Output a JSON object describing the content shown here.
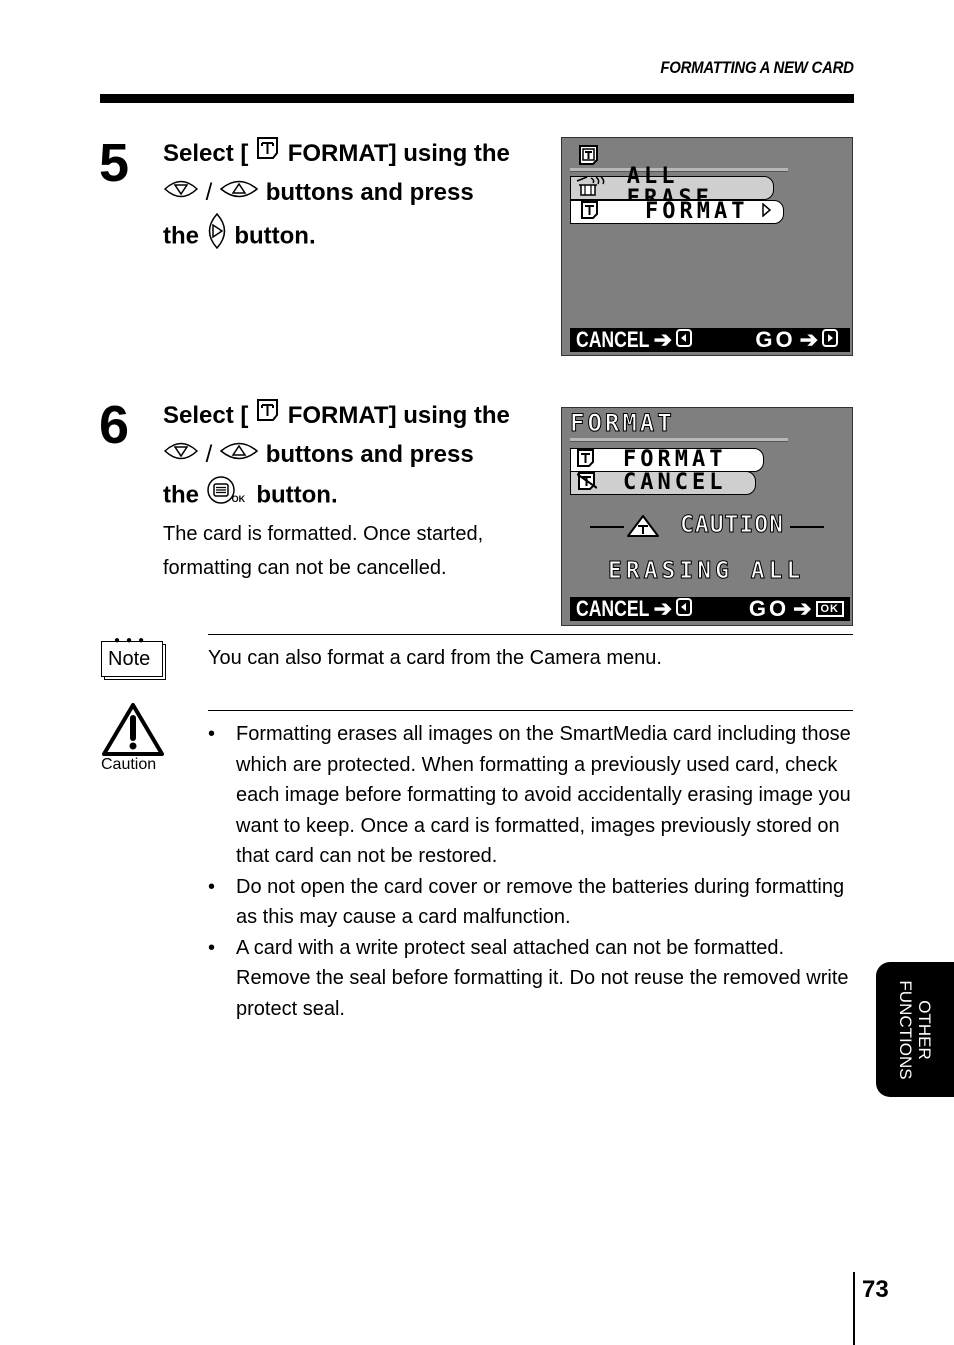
{
  "header": {
    "title": "FORMATTING A NEW CARD"
  },
  "steps": [
    {
      "number": "5",
      "line1_pre": "Select [",
      "line1_post": "FORMAT] using the",
      "line2_sep": "/",
      "line2_post": "buttons and press",
      "line3_pre": "the",
      "line3_post": "button.",
      "icons": [
        "card-format-icon",
        "down-arrow-button-icon",
        "up-arrow-button-icon",
        "right-arrow-button-icon"
      ],
      "screen": {
        "top_icon": "card-format-icon",
        "menu": [
          {
            "icon": "all-erase-icon",
            "label": "ALL ERASE",
            "selected": false
          },
          {
            "icon": "card-format-icon",
            "label": "FORMAT",
            "selected": true,
            "arrow": "right"
          }
        ],
        "bottom_left": "CANCEL",
        "bottom_left_key": "left-key-icon",
        "bottom_right": "GO",
        "bottom_right_key": "right-key-icon"
      }
    },
    {
      "number": "6",
      "line1_pre": "Select [",
      "line1_post": "FORMAT] using the",
      "line2_sep": "/",
      "line2_post": "buttons and press",
      "line3_pre": "the",
      "line3_post": "button.",
      "ok_sub": "OK",
      "description": "The card is formatted. Once started, formatting can not be cancelled.",
      "icons": [
        "card-format-icon",
        "down-arrow-button-icon",
        "up-arrow-button-icon",
        "ok-menu-button-icon"
      ],
      "screen": {
        "title": "FORMAT",
        "menu": [
          {
            "icon": "card-format-icon",
            "label": "FORMAT",
            "selected": true
          },
          {
            "icon": "card-cancel-icon",
            "label": "CANCEL",
            "selected": false
          }
        ],
        "caution_label": "CAUTION",
        "message": "ERASING ALL",
        "bottom_left": "CANCEL",
        "bottom_left_key": "left-key-icon",
        "bottom_right": "GO",
        "bottom_right_key": "OK"
      }
    }
  ],
  "note": {
    "icon_label": "Note",
    "text": "You can also format a card from the Camera menu."
  },
  "caution": {
    "icon_label": "Caution",
    "bullets": [
      "Formatting erases all images on the SmartMedia card including those which are protected. When formatting a previously used card, check each image before formatting to avoid accidentally erasing image you want to keep. Once a card is formatted, images previously stored on that card can not be restored.",
      "Do not open the card cover or remove the batteries during formatting as this may cause a card malfunction.",
      "A card with a write protect seal attached can not be formatted. Remove the seal before formatting it. Do not reuse the removed write protect seal."
    ]
  },
  "side_tab": {
    "line1": "OTHER",
    "line2": "FUNCTIONS"
  },
  "page_number": "73"
}
